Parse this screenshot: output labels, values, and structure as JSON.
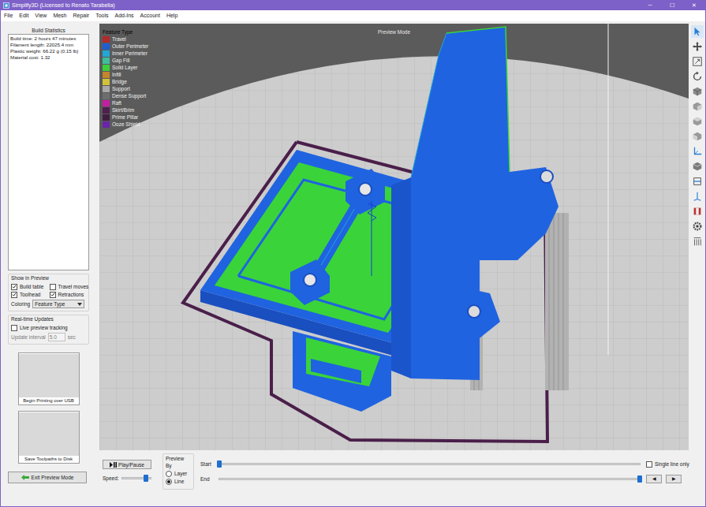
{
  "window": {
    "title": "Simplify3D (Licensed to Renato Tarabella)",
    "controls": [
      "─",
      "☐",
      "✕"
    ]
  },
  "menu": [
    "File",
    "Edit",
    "View",
    "Mesh",
    "Repair",
    "Tools",
    "Add-Ins",
    "Account",
    "Help"
  ],
  "build_statistics": {
    "title": "Build Statistics",
    "lines": [
      "Build time: 2 hours 47 minutes",
      "Filament length: 22025.4 mm",
      "Plastic weight: 66.22 g (0.15 lb)",
      "Material cost: 1.32"
    ]
  },
  "show_in_preview": {
    "title": "Show in Preview",
    "options": [
      {
        "label": "Build table",
        "checked": true
      },
      {
        "label": "Travel moves",
        "checked": false
      },
      {
        "label": "Toolhead",
        "checked": true
      },
      {
        "label": "Retractions",
        "checked": true
      }
    ],
    "coloring_label": "Coloring",
    "coloring_value": "Feature Type"
  },
  "realtime_updates": {
    "title": "Real-time Updates",
    "live_tracking": {
      "label": "Live preview tracking",
      "checked": false
    },
    "interval_label": "Update interval",
    "interval_value": "5.0",
    "interval_unit": "sec"
  },
  "action_buttons": [
    {
      "label": "Begin Printing over USB"
    },
    {
      "label": "Save Toolpaths to Disk"
    }
  ],
  "exit_button": "Exit Preview Mode",
  "viewport": {
    "mode": "Preview Mode",
    "legend_title": "Feature Type",
    "legend": [
      {
        "label": "Travel",
        "color": "#b22a2a"
      },
      {
        "label": "Outer Perimeter",
        "color": "#1f5fcf"
      },
      {
        "label": "Inner Perimeter",
        "color": "#22a7d8"
      },
      {
        "label": "Gap Fill",
        "color": "#3dbf9a"
      },
      {
        "label": "Solid Layer",
        "color": "#3ccf3c"
      },
      {
        "label": "Infill",
        "color": "#c4862a"
      },
      {
        "label": "Bridge",
        "color": "#d2c23a"
      },
      {
        "label": "Support",
        "color": "#a8a8a8"
      },
      {
        "label": "Dense Support",
        "color": "#6e6e6e"
      },
      {
        "label": "Raft",
        "color": "#c21fa3"
      },
      {
        "label": "Skirt/Brim",
        "color": "#4f1f4f"
      },
      {
        "label": "Prime Pillar",
        "color": "#3f1f3f"
      },
      {
        "label": "Ooze Shield",
        "color": "#6a24a8"
      }
    ]
  },
  "playback": {
    "button": "Play/Pause",
    "speed_label": "Speed:",
    "speed_level": 0.85
  },
  "preview_by": {
    "title": "Preview By",
    "options": [
      {
        "label": "Layer",
        "selected": false
      },
      {
        "label": "Line",
        "selected": true
      }
    ]
  },
  "range": [
    {
      "label": "Start",
      "level": 0
    },
    {
      "label": "End",
      "level": 1
    }
  ],
  "single_line": {
    "label": "Single line only",
    "checked": false
  },
  "step_buttons": [
    "◀",
    "▶"
  ]
}
